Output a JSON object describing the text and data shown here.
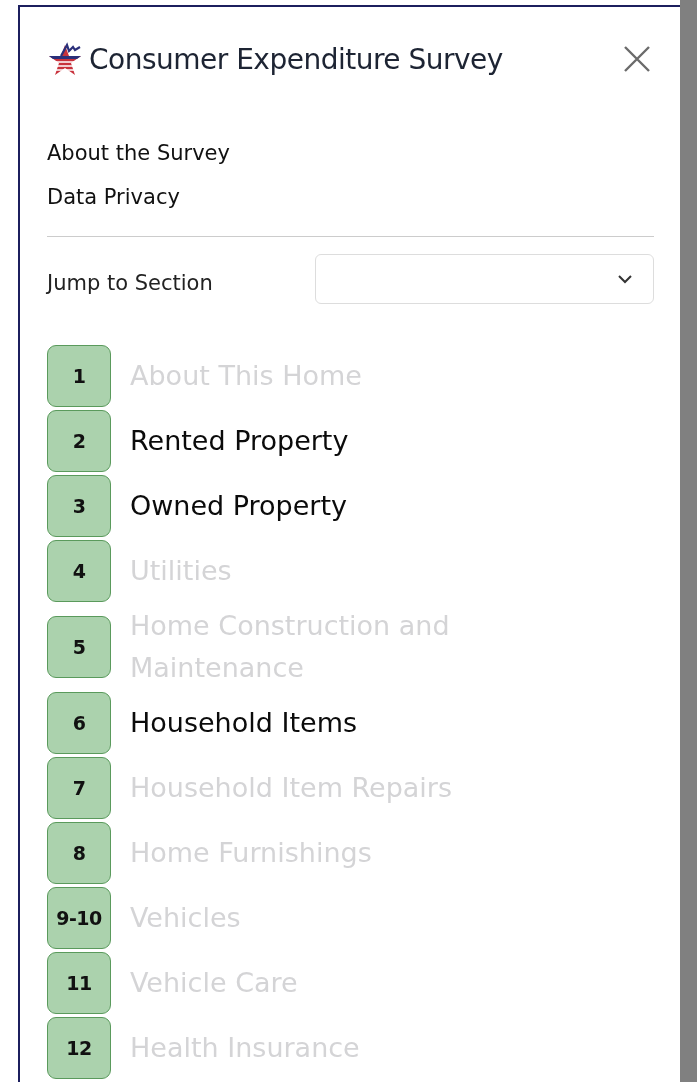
{
  "header": {
    "title": "Consumer Expenditure Survey"
  },
  "links": [
    "About the Survey",
    "Data Privacy"
  ],
  "jump": {
    "label": "Jump to Section"
  },
  "sections": [
    {
      "number": "1",
      "title": "About This Home",
      "disabled": true
    },
    {
      "number": "2",
      "title": "Rented Property",
      "disabled": false
    },
    {
      "number": "3",
      "title": "Owned Property",
      "disabled": false
    },
    {
      "number": "4",
      "title": "Utilities",
      "disabled": true
    },
    {
      "number": "5",
      "title": "Home Construction and Maintenance",
      "disabled": true
    },
    {
      "number": "6",
      "title": "Household Items",
      "disabled": false
    },
    {
      "number": "7",
      "title": "Household Item Repairs",
      "disabled": true
    },
    {
      "number": "8",
      "title": "Home Furnishings",
      "disabled": true
    },
    {
      "number": "9-10",
      "title": "Vehicles",
      "disabled": true
    },
    {
      "number": "11",
      "title": "Vehicle Care",
      "disabled": true
    },
    {
      "number": "12",
      "title": "Health Insurance",
      "disabled": true
    }
  ]
}
